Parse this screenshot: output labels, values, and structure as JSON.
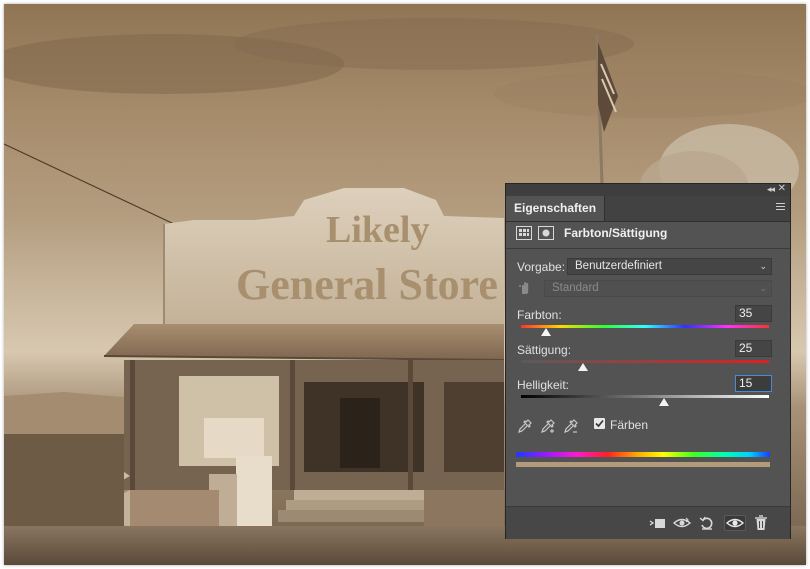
{
  "panel": {
    "title": "Eigenschaften",
    "adjustment_title": "Farbton/Sättigung",
    "preset_label": "Vorgabe:",
    "preset_value": "Benutzerdefiniert",
    "channel_value": "Standard",
    "hue_label": "Farbton:",
    "hue_value": "35",
    "saturation_label": "Sättigung:",
    "saturation_value": "25",
    "lightness_label": "Helligkeit:",
    "lightness_value": "15",
    "colorize_label": "Färben",
    "colorize_checked": true,
    "colors": {
      "panel_bg": "#535353",
      "input_bg": "#454545",
      "active_border": "#4b8bd6",
      "sepia_bar": "#b39a7a"
    },
    "sliders": {
      "hue_fraction": 0.1,
      "saturation_fraction": 0.25,
      "lightness_fraction": 0.575
    }
  },
  "photo": {
    "sign_line1": "Likely",
    "sign_line2": "General Store",
    "tone": "sepia"
  }
}
